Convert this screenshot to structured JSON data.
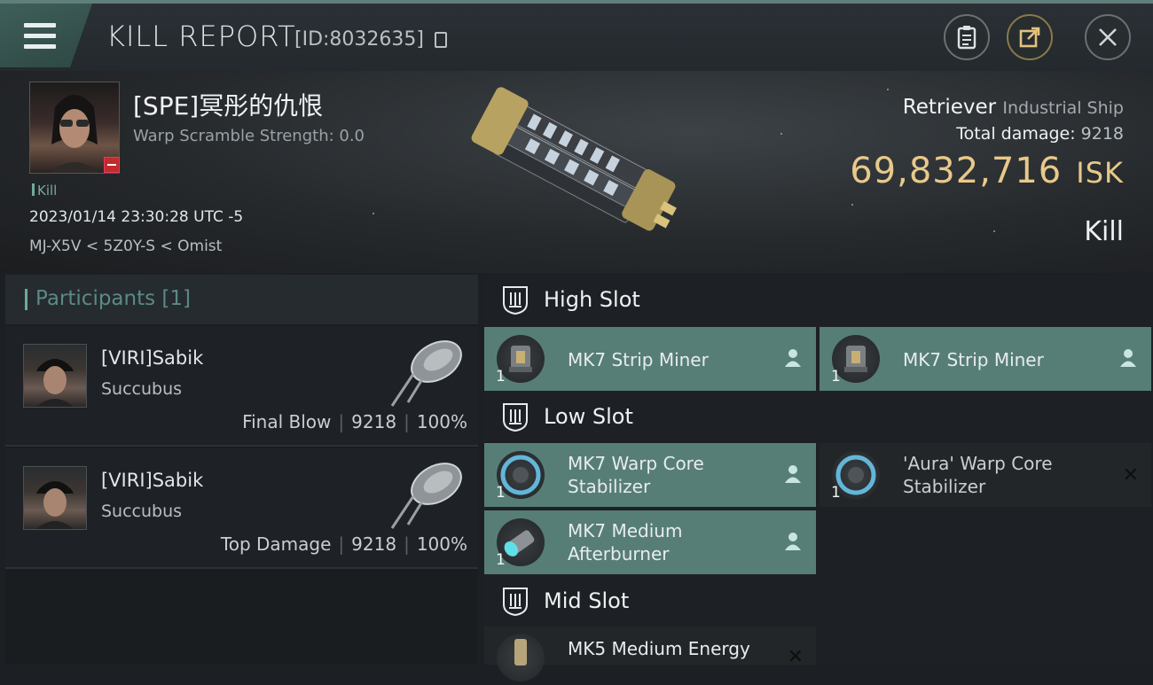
{
  "topbar": {
    "menu_icon": "hamburger-icon",
    "title": "KILL REPORT",
    "kill_id": "[ID:8032635]",
    "actions": [
      {
        "icon": "clipboard-icon"
      },
      {
        "icon": "share-icon"
      },
      {
        "icon": "close-icon"
      }
    ]
  },
  "victim": {
    "name": "[SPE]冥彤的仇恨",
    "warp_scramble": "Warp Scramble Strength: 0.0",
    "tag": "Kill",
    "datetime": "2023/01/14 23:30:28 UTC -5",
    "location": "MJ-X5V < 5Z0Y-S < Omist",
    "ship_name": "Retriever",
    "ship_class": "Industrial Ship",
    "total_damage_label": "Total damage:",
    "total_damage": "9218",
    "isk_value": "69,832,716",
    "isk_unit": "ISK",
    "result": "Kill"
  },
  "participants": {
    "label": "Participants [1]",
    "items": [
      {
        "name": "[VIRI]Sabik",
        "ship": "Succubus",
        "role": "Final Blow",
        "damage": "9218",
        "percent": "100%"
      },
      {
        "name": "[VIRI]Sabik",
        "ship": "Succubus",
        "role": "Top Damage",
        "damage": "9218",
        "percent": "100%"
      }
    ]
  },
  "fitting": {
    "high_slot": {
      "label": "High Slot",
      "modules": [
        {
          "name": "MK7 Strip Miner",
          "qty": "1"
        },
        {
          "name": "MK7 Strip Miner",
          "qty": "1"
        }
      ]
    },
    "low_slot": {
      "label": "Low Slot",
      "modules": [
        {
          "name_line1": "MK7 Warp Core",
          "name_line2": "Stabilizer",
          "qty": "1"
        },
        {
          "name_line1": "'Aura' Warp Core",
          "name_line2": "Stabilizer",
          "qty": "1"
        },
        {
          "name_line1": "MK7 Medium",
          "name_line2": "Afterburner",
          "qty": "1"
        }
      ]
    },
    "mid_slot": {
      "label": "Mid Slot",
      "modules": [
        {
          "name": "MK5 Medium Energy"
        }
      ]
    }
  },
  "colors": {
    "accent_teal": "#567e77",
    "isk_gold": "#e8c98a"
  }
}
